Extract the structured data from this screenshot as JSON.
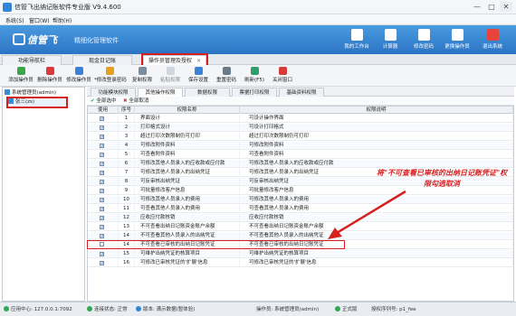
{
  "window": {
    "title": "信管飞出纳记账软件专业版 V9.4.600",
    "controls": [
      "—",
      "□",
      "✕"
    ]
  },
  "menu": [
    "系统(S)",
    "窗口(W)",
    "帮助(H)"
  ],
  "banner": {
    "logo": "信管飞",
    "slogan": "精细化管理软件",
    "buttons": [
      {
        "label": "我的工作台",
        "icon": "monitor-icon",
        "color": "#ffffff"
      },
      {
        "label": "计算器",
        "icon": "calculator-icon",
        "color": "#ffffff"
      },
      {
        "label": "修改密码",
        "icon": "lock-icon",
        "color": "#ffffff"
      },
      {
        "label": "更换操作员",
        "icon": "user-swap-icon",
        "color": "#ffffff"
      },
      {
        "label": "退出系统",
        "icon": "exit-icon",
        "color": "#e8443a"
      }
    ]
  },
  "main_tabs": [
    "功能导航栏",
    "现金日记账",
    "操作员管理及授权"
  ],
  "main_tab_close": "✕",
  "toolbar": [
    {
      "label": "添加操作员",
      "icon": "add-user-icon",
      "color": "#3aa648"
    },
    {
      "label": "删除操作员",
      "icon": "delete-user-icon",
      "color": "#d83a3a"
    },
    {
      "label": "修改操作员",
      "icon": "edit-user-icon",
      "color": "#3b82d6"
    },
    {
      "label": "*修改登录密码",
      "icon": "key-icon",
      "color": "#e3a21a"
    },
    {
      "label": "复制权限",
      "icon": "copy-icon",
      "color": "#7a8ca0"
    },
    {
      "label": "粘贴权限",
      "icon": "paste-icon",
      "color": "#b5bec9"
    },
    {
      "label": "保存设置",
      "icon": "save-icon",
      "color": "#3b82d6"
    },
    {
      "label": "重置密码",
      "icon": "reset-icon",
      "color": "#6c7a8a"
    },
    {
      "label": "刷新(F5)",
      "icon": "refresh-icon",
      "color": "#2f9e6b"
    },
    {
      "label": "关闭窗口",
      "icon": "close-icon",
      "color": "#d83a3a"
    }
  ],
  "tree": [
    {
      "label": "系统管理员(admin)",
      "selected": false
    },
    {
      "label": "张三(zs)",
      "selected": true
    }
  ],
  "sub_tabs": [
    "功能模块权限",
    "其他操作权限",
    "数据权限",
    "票据打印权限",
    "基础资料权限"
  ],
  "sub_actions": {
    "select_all": "全部选中",
    "clear_all": "全部取消"
  },
  "grid": {
    "headers": [
      "使用",
      "序号",
      "权限名称",
      "权限说明"
    ],
    "rows": [
      {
        "use": true,
        "idx": "1",
        "name": "界面设计",
        "desc": "可设计操作界面"
      },
      {
        "use": true,
        "idx": "2",
        "name": "打印格式设计",
        "desc": "可设计打印格式"
      },
      {
        "use": true,
        "idx": "3",
        "name": "超过打印次数限制仍可打印",
        "desc": "超过打印次数限制仍可打印"
      },
      {
        "use": true,
        "idx": "4",
        "name": "可修改附件资料",
        "desc": "可修改附件资料"
      },
      {
        "use": true,
        "idx": "5",
        "name": "可查看附件资料",
        "desc": "可查看附件资料"
      },
      {
        "use": true,
        "idx": "6",
        "name": "可修改其他人员录入的应收款或应付款",
        "desc": "可修改其他人员录入的应收款或应付款"
      },
      {
        "use": true,
        "idx": "7",
        "name": "可修改其他人员录入的出纳凭证",
        "desc": "可修改其他人员录入的出纳凭证"
      },
      {
        "use": true,
        "idx": "8",
        "name": "可反审核出纳凭证",
        "desc": "可反审核出纳凭证"
      },
      {
        "use": true,
        "idx": "9",
        "name": "可批量修改客户信息",
        "desc": "可批量修改客户信息"
      },
      {
        "use": true,
        "idx": "10",
        "name": "可修改其他人员录入的费用",
        "desc": "可修改其他人员录入的费用"
      },
      {
        "use": true,
        "idx": "11",
        "name": "可查看其他人员录入的费用",
        "desc": "可查看其他人员录入的费用"
      },
      {
        "use": true,
        "idx": "12",
        "name": "应收应付款核销",
        "desc": "应收应付款核销"
      },
      {
        "use": true,
        "idx": "13",
        "name": "不可查看出纳日记账资金账户余额",
        "desc": "不可查看出纳日记账资金账户余额"
      },
      {
        "use": true,
        "idx": "14",
        "name": "不可查看其他人员录入的出纳凭证",
        "desc": "不可查看其他人员录入的出纳凭证"
      },
      {
        "use": false,
        "idx": "14",
        "name": "不可查看已审核的出纳日记账凭证",
        "desc": "不可查看已审核的出纳日记账凭证"
      },
      {
        "use": true,
        "idx": "15",
        "name": "可维护出纳凭证的核算项目",
        "desc": "可维护出纳凭证的核算项目"
      },
      {
        "use": true,
        "idx": "16",
        "name": "可修改已审核凭证的'扩展'信息",
        "desc": "可修改已审核凭证的'扩展'信息"
      }
    ],
    "highlight_row_index": 14
  },
  "annotation": "将\"不可查看已审核的出纳日记账凭证\"权限勾选取消",
  "status": {
    "server": "应用中心: 127.0.0.1:7092",
    "connection": "连接状态: 正常",
    "version": "版本: 满示数据(暂体验)",
    "operator": "操作员: 系统管理员(admin)",
    "edition": "正式版",
    "license": "授权序列号: p1_fee",
    "colors": {
      "ok": "#2fa84f",
      "warn": "#2f86d6"
    }
  },
  "accent": "#2c74c4",
  "annotation_color": "#d62020"
}
